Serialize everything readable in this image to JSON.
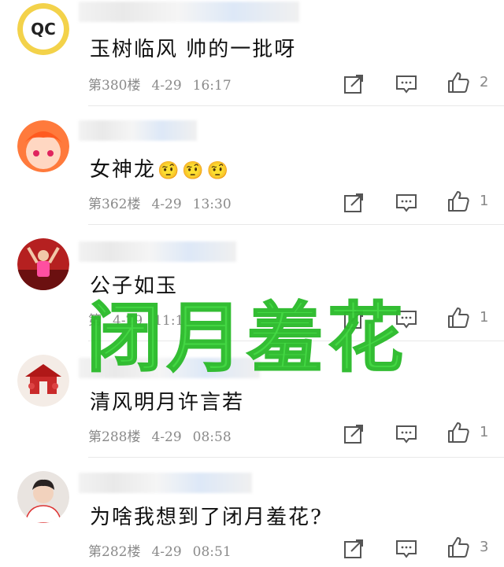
{
  "comments": [
    {
      "content": "玉树临风 帅的一批呀",
      "floor": "第380楼",
      "date": "4-29",
      "time": "16:17",
      "likes": "2",
      "avatar_icon": "qc-logo-avatar"
    },
    {
      "content": "女神龙",
      "emojis": [
        "🤨",
        "🤨",
        "🤨"
      ],
      "floor": "第362楼",
      "date": "4-29",
      "time": "13:30",
      "likes": "1",
      "avatar_icon": "cartoon-girl-avatar"
    },
    {
      "content": "公子如玉",
      "floor": "第",
      "date": "4-29",
      "time": "11:1",
      "likes": "1",
      "avatar_icon": "stage-performer-avatar"
    },
    {
      "content": "清风明月许言若",
      "floor": "第288楼",
      "date": "4-29",
      "time": "08:58",
      "likes": "1",
      "avatar_icon": "red-palace-avatar"
    },
    {
      "content": "为啥我想到了闭月羞花?",
      "floor": "第282楼",
      "date": "4-29",
      "time": "08:51",
      "likes": "3",
      "avatar_icon": "young-man-avatar"
    }
  ],
  "watermark": "闭月羞花",
  "colors": {
    "watermark": "#3dd63d",
    "meta": "#8a8a8a",
    "divider": "#e8e8e8"
  }
}
